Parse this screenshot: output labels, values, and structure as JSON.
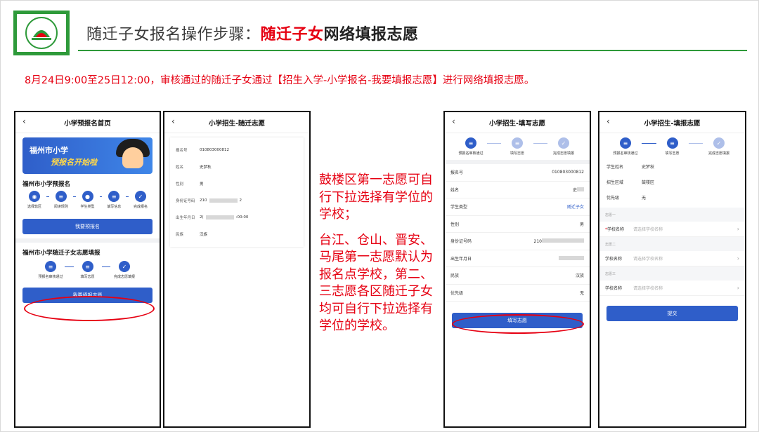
{
  "header": {
    "title_prefix": "随迁子女报名操作步骤：",
    "title_red": "随迁子女",
    "title_suffix": "网络填报志愿",
    "description": "8月24日9:00至25日12:00，审核通过的随迁子女通过【招生入学-小学报名-我要填报志愿】进行网络填报志愿。"
  },
  "colors": {
    "accent_red": "#e60012",
    "primary_blue": "#2f5ec9",
    "brand_green": "#2e9a3a"
  },
  "panel1": {
    "header": "小学预报名首页",
    "banner_line1": "福州市小学",
    "banner_line2": "预报名开始啦",
    "section1_title": "福州市小学预报名",
    "steps1": [
      "选择辖区",
      "阅读规则",
      "学生类型",
      "填写信息",
      "完成报名"
    ],
    "button1": "我要预报名",
    "section2_title": "福州市小学随迁子女志愿填报",
    "steps2": [
      "预报名审核通过",
      "填写志愿",
      "完成志愿填报"
    ],
    "button2": "我要填报志愿"
  },
  "panel2": {
    "header": "小学招生-随迁志愿",
    "rows": [
      {
        "k": "报名号",
        "v": "010803000812"
      },
      {
        "k": "姓名",
        "v": "史梦秋"
      },
      {
        "k": "性别",
        "v": "男"
      },
      {
        "k": "身份证号码",
        "v": "210",
        "tail": "2"
      },
      {
        "k": "出生年月日",
        "v": "2(",
        "tail": ":00:00"
      },
      {
        "k": "民族",
        "v": "汉族"
      }
    ]
  },
  "notes": {
    "p1": "鼓楼区第一志愿可自行下拉选择有学位的学校；",
    "p2": "台江、仓山、晋安、马尾第一志愿默认为报名点学校，第二、三志愿各区随迁子女均可自行下拉选择有学位的学校。"
  },
  "panel3": {
    "header": "小学招生-填写志愿",
    "steps": [
      "预报名审核通过",
      "填写志愿",
      "完成志愿填报"
    ],
    "rows": [
      {
        "k": "报名号",
        "v": "010803000812"
      },
      {
        "k": "姓名",
        "v": "史"
      },
      {
        "k": "学生类型",
        "v": "随迁子女"
      },
      {
        "k": "性别",
        "v": "男"
      },
      {
        "k": "身份证号码",
        "v": "210"
      },
      {
        "k": "出生年月日",
        "v": ""
      },
      {
        "k": "民族",
        "v": "汉族"
      },
      {
        "k": "优先级",
        "v": "无"
      }
    ],
    "button": "填写志愿"
  },
  "panel4": {
    "header": "小学招生-填报志愿",
    "steps": [
      "预报名审核通过",
      "填写志愿",
      "完成志愿填报"
    ],
    "info": [
      {
        "k": "学生姓名",
        "v": "史梦秋"
      },
      {
        "k": "招生区域",
        "v": "鼓楼区"
      },
      {
        "k": "优先级",
        "v": "无"
      }
    ],
    "groups": [
      {
        "label": "志愿一",
        "field": "学校名称",
        "placeholder": "请选择学校名称",
        "required": "*"
      },
      {
        "label": "志愿二",
        "field": "学校名称",
        "placeholder": "请选择学校名称",
        "required": ""
      },
      {
        "label": "志愿三",
        "field": "学校名称",
        "placeholder": "请选择学校名称",
        "required": ""
      }
    ],
    "button": "提交"
  }
}
